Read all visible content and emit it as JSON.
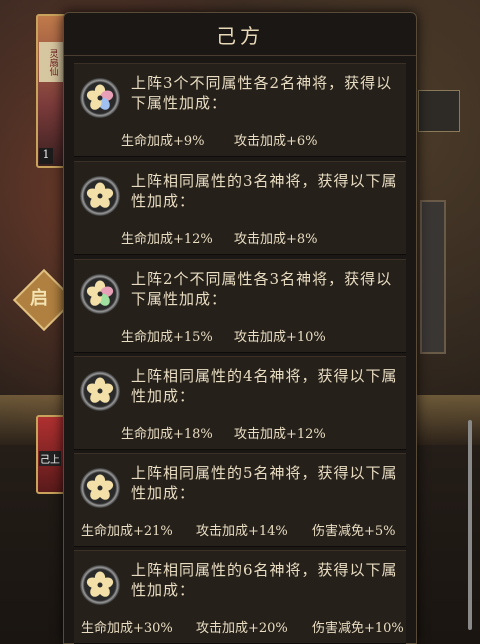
{
  "dialog": {
    "title": "己方"
  },
  "background": {
    "card_top_tag": "灵扇仙",
    "card_top_number": "1",
    "card_bottom_label": "己上",
    "side_button_char": "启"
  },
  "panels": [
    {
      "icon_colors": [
        "#f2e0a8",
        "#e8a0b8",
        "#a0c0f0",
        "#f2e0a8",
        "#f2e0a8"
      ],
      "description": "上阵3个不同属性各2名神将，获得以下属性加成：",
      "bonuses": [
        "生命加成+9%",
        "攻击加成+6%"
      ]
    },
    {
      "icon_colors": [
        "#f2e0a8",
        "#f2e0a8",
        "#f2e0a8",
        "#f2e0a8",
        "#f2e0a8"
      ],
      "description": "上阵相同属性的3名神将，获得以下属性加成：",
      "bonuses": [
        "生命加成+12%",
        "攻击加成+8%"
      ]
    },
    {
      "icon_colors": [
        "#f2e0a8",
        "#e8a0b8",
        "#a0e0a0",
        "#f2e0a8",
        "#f2e0a8"
      ],
      "description": "上阵2个不同属性各3名神将，获得以下属性加成：",
      "bonuses": [
        "生命加成+15%",
        "攻击加成+10%"
      ]
    },
    {
      "icon_colors": [
        "#f2e0a8",
        "#f2e0a8",
        "#f2e0a8",
        "#f2e0a8",
        "#f2e0a8"
      ],
      "description": "上阵相同属性的4名神将，获得以下属性加成：",
      "bonuses": [
        "生命加成+18%",
        "攻击加成+12%"
      ]
    },
    {
      "icon_colors": [
        "#f2e0a8",
        "#f2e0a8",
        "#f2e0a8",
        "#f2e0a8",
        "#f2e0a8"
      ],
      "description": "上阵相同属性的5名神将，获得以下属性加成：",
      "bonuses": [
        "生命加成+21%",
        "攻击加成+14%",
        "伤害减免+5%"
      ]
    },
    {
      "icon_colors": [
        "#f2e0a8",
        "#f2e0a8",
        "#f2e0a8",
        "#f2e0a8",
        "#f2e0a8"
      ],
      "description": "上阵相同属性的6名神将，获得以下属性加成：",
      "bonuses": [
        "生命加成+30%",
        "攻击加成+20%",
        "伤害减免+10%"
      ]
    }
  ]
}
